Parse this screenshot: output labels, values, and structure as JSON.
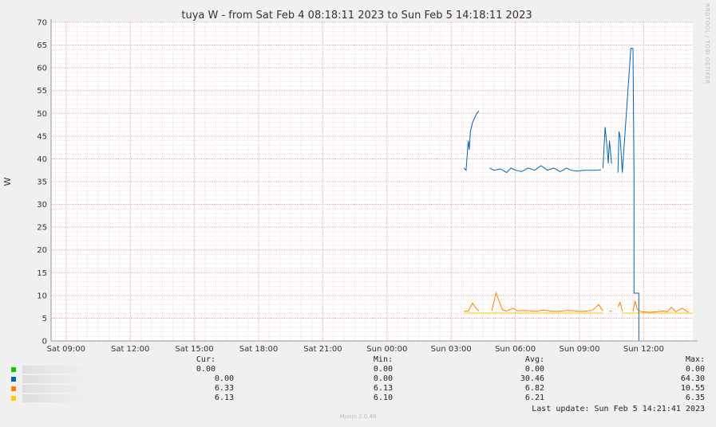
{
  "chart_data": {
    "type": "line",
    "title": "tuya W - from Sat Feb  4 08:18:11 2023 to Sun Feb  5 14:18:11 2023",
    "ylabel": "W",
    "ylim": [
      0,
      70
    ],
    "y_ticks": [
      0,
      5,
      10,
      15,
      20,
      25,
      30,
      35,
      40,
      45,
      50,
      55,
      60,
      65,
      70
    ],
    "x_range_hours": [
      8.3,
      38.3
    ],
    "x_tick_labels": [
      "Sat 09:00",
      "Sat 12:00",
      "Sat 15:00",
      "Sat 18:00",
      "Sat 21:00",
      "Sun 00:00",
      "Sun 03:00",
      "Sun 06:00",
      "Sun 09:00",
      "Sun 12:00"
    ],
    "x_tick_hours": [
      9,
      12,
      15,
      18,
      21,
      24,
      27,
      30,
      33,
      36
    ],
    "grid": true,
    "series": [
      {
        "color": "#00cc00",
        "x": [
          27.6,
          38.3
        ],
        "y": [
          0,
          0
        ]
      },
      {
        "color": "#0066b3",
        "x": [
          27.6,
          27.7,
          27.8,
          27.85,
          27.9,
          28.0,
          28.1,
          28.2,
          28.3,
          28.7,
          28.8,
          29.0,
          29.3,
          29.6,
          29.8,
          30.0,
          30.3,
          30.6,
          30.9,
          31.2,
          31.5,
          31.8,
          32.1,
          32.4,
          32.6,
          32.9,
          33.2,
          33.5,
          33.8,
          34.0,
          34.0,
          34.1,
          34.2,
          34.3,
          34.35,
          34.4,
          34.5,
          34.7,
          34.8,
          34.85,
          34.9,
          35.0,
          35.4,
          35.5
        ],
        "y": [
          38,
          37.5,
          44,
          42,
          46,
          48,
          49,
          50,
          50.5,
          null,
          38,
          37.5,
          37.8,
          37,
          38,
          37.5,
          37.2,
          38,
          37.5,
          38.5,
          37.5,
          38,
          37.2,
          38,
          37.5,
          37.3,
          37.5,
          37.5,
          37.5,
          37.6,
          null,
          38,
          47,
          42,
          39,
          44,
          39,
          null,
          37,
          46,
          45,
          37,
          64.3,
          64.3
        ]
      },
      {
        "color": "#ff8000",
        "x": [
          27.6,
          27.8,
          28.0,
          28.2,
          28.3,
          28.7,
          28.9,
          29.1,
          29.4,
          29.6,
          29.9,
          30.1,
          30.4,
          30.7,
          31.0,
          31.3,
          31.6,
          31.9,
          32.2,
          32.5,
          32.8,
          33.1,
          33.4,
          33.6,
          33.9,
          34.1,
          34.3,
          34.4,
          34.5,
          34.7,
          34.8,
          34.9,
          35.0,
          35.4,
          35.5,
          35.6,
          35.7,
          35.9,
          36.3,
          36.6,
          36.9,
          37.1,
          37.3,
          37.5,
          37.8,
          38.1
        ],
        "y": [
          6.5,
          6.6,
          8.3,
          7.0,
          6.6,
          null,
          6.6,
          10.55,
          6.8,
          6.6,
          7.2,
          6.6,
          6.7,
          6.6,
          6.5,
          6.8,
          6.6,
          6.5,
          6.6,
          6.7,
          6.6,
          6.5,
          6.6,
          6.7,
          8.0,
          6.6,
          null,
          6.5,
          6.6,
          null,
          7.5,
          8.5,
          6.5,
          null,
          6.5,
          8.8,
          7.0,
          6.4,
          6.3,
          6.4,
          6.6,
          6.4,
          7.4,
          6.4,
          7.2,
          6.33
        ]
      },
      {
        "color": "#ffcc00",
        "x": [
          27.6,
          34.1,
          34.7,
          35.0,
          35.5,
          38.3
        ],
        "y": [
          6.13,
          6.13,
          null,
          6.13,
          6.13,
          6.13
        ]
      }
    ]
  },
  "legend": {
    "headers": {
      "cur": "Cur:",
      "min": "Min:",
      "avg": "Avg:",
      "max": "Max:"
    },
    "rows": [
      {
        "color": "#00cc00",
        "cur": "0.00",
        "min": "0.00",
        "avg": "0.00",
        "max": "0.00"
      },
      {
        "color": "#0066b3",
        "cur": "0.00",
        "min": "0.00",
        "avg": "30.46",
        "max": "64.30"
      },
      {
        "color": "#ff8000",
        "cur": "6.33",
        "min": "6.13",
        "avg": "6.82",
        "max": "10.55"
      },
      {
        "color": "#ffcc00",
        "cur": "6.13",
        "min": "6.10",
        "avg": "6.21",
        "max": "6.35"
      }
    ]
  },
  "last_update": "Last update: Sun Feb  5 14:21:41 2023",
  "side_text": "RRDTOOL / TOBI OETIKER",
  "footer": "Munin 2.0.49"
}
